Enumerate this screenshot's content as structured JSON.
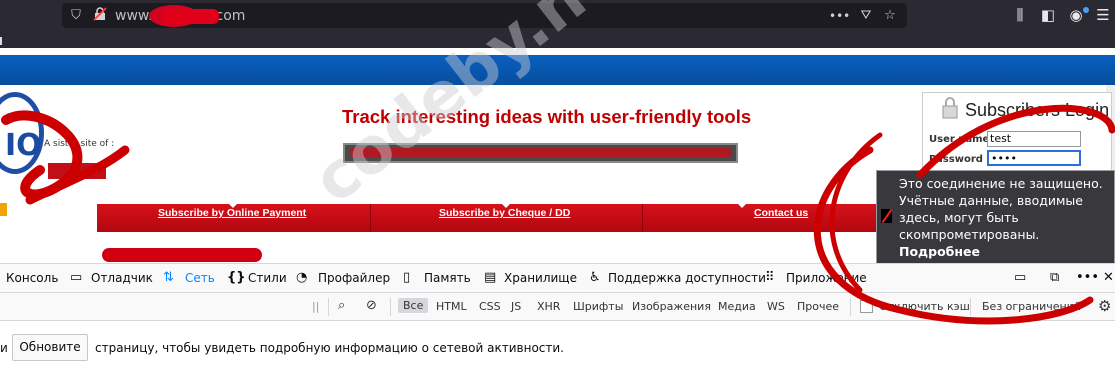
{
  "browser": {
    "url_prefix": "www.",
    "url_suffix": "com",
    "icons": [
      "shield-icon",
      "insecure-lock-icon",
      "more-icon",
      "pocket-icon",
      "bookmark-star-icon",
      "library-icon",
      "sidebar-icon",
      "account-icon",
      "menu-icon"
    ]
  },
  "site": {
    "logo_text": "IO",
    "sister_site_label": "A sister site of :",
    "headline": "Track interesting ideas with user-friendly tools",
    "nav": [
      "Subscribe by Online Payment",
      "Subscribe by Cheque / DD",
      "Contact us"
    ],
    "colors": {
      "brand_red": "#c00000",
      "nav_red": "#d7111b",
      "top_bar_blue": "#0a5fbf"
    }
  },
  "login": {
    "title": "Subscribers Login",
    "username_label": "User name",
    "username_value": "test",
    "password_label": "Password",
    "password_value": "••••"
  },
  "tooltip": {
    "message": "Это соединение не защищено. Учётные данные, вводимые здесь, могут быть скомпрометированы.",
    "more": "Подробнее"
  },
  "devtools": {
    "tabs": [
      "Консоль",
      "Отладчик",
      "Сеть",
      "Стили",
      "Профайлер",
      "Память",
      "Хранилище",
      "Поддержка доступности",
      "Приложение"
    ],
    "active_tab": "Сеть",
    "filters": [
      "Все",
      "HTML",
      "CSS",
      "JS",
      "XHR",
      "Шрифты",
      "Изображения",
      "Медиа",
      "WS",
      "Прочее"
    ],
    "disable_cache": "Отключить кэш",
    "throttle": "Без ограничений",
    "reload_prefix": "и",
    "reload_button": "Обновите",
    "reload_suffix": "страницу, чтобы увидеть подробную информацию о сетевой активности."
  },
  "watermark": "codeby.net"
}
